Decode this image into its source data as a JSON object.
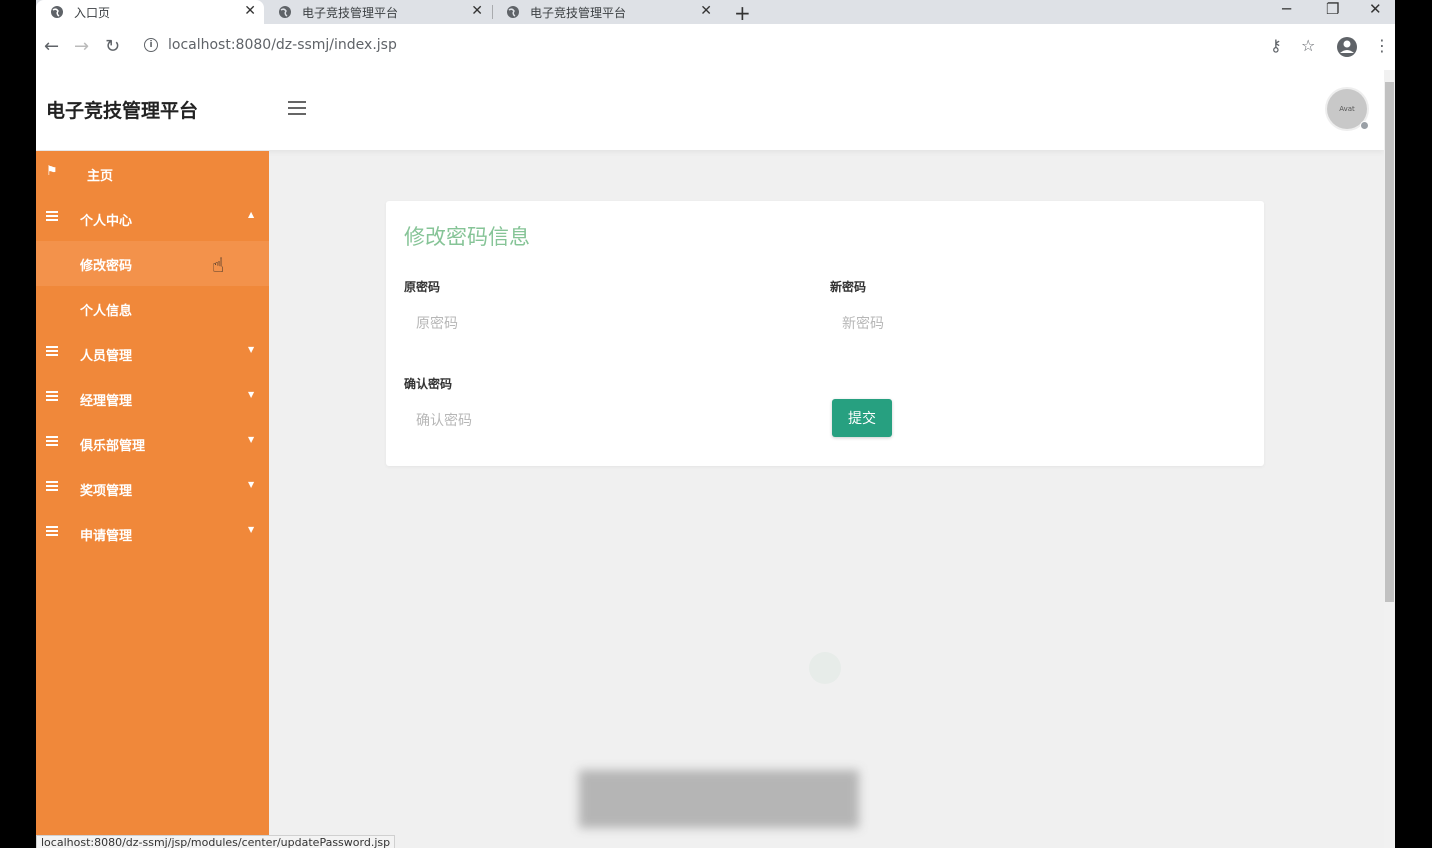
{
  "browser": {
    "tabs": [
      {
        "title": "入口页",
        "active": true
      },
      {
        "title": "电子竞技管理平台",
        "active": false
      },
      {
        "title": "电子竞技管理平台",
        "active": false
      }
    ],
    "url": "localhost:8080/dz-ssmj/index.jsp",
    "status_url": "localhost:8080/dz-ssmj/jsp/modules/center/updatePassword.jsp",
    "icons": {
      "back": "back-arrow-icon",
      "forward": "forward-arrow-icon",
      "reload": "reload-icon",
      "key": "key-icon",
      "star": "star-icon",
      "account": "account-icon",
      "menu": "more-vert-icon"
    }
  },
  "app": {
    "title": "电子竞技管理平台",
    "avatar_text": "Avat"
  },
  "sidebar": {
    "items": [
      {
        "label": "主页",
        "icon": "flag-icon"
      },
      {
        "label": "个人中心",
        "icon": "list-icon",
        "expanded": true
      },
      {
        "label": "修改密码",
        "sub": true,
        "active": true
      },
      {
        "label": "个人信息",
        "sub": true
      },
      {
        "label": "人员管理",
        "icon": "list-icon"
      },
      {
        "label": "经理管理",
        "icon": "list-icon"
      },
      {
        "label": "俱乐部管理",
        "icon": "list-icon"
      },
      {
        "label": "奖项管理",
        "icon": "list-icon"
      },
      {
        "label": "申请管理",
        "icon": "list-icon"
      }
    ]
  },
  "form": {
    "title": "修改密码信息",
    "old_password_label": "原密码",
    "old_password_placeholder": "原密码",
    "new_password_label": "新密码",
    "new_password_placeholder": "新密码",
    "confirm_password_label": "确认密码",
    "confirm_password_placeholder": "确认密码",
    "submit_label": "提交"
  },
  "colors": {
    "sidebar": "#f0883a",
    "title": "#86c497",
    "submit": "#27a080"
  }
}
